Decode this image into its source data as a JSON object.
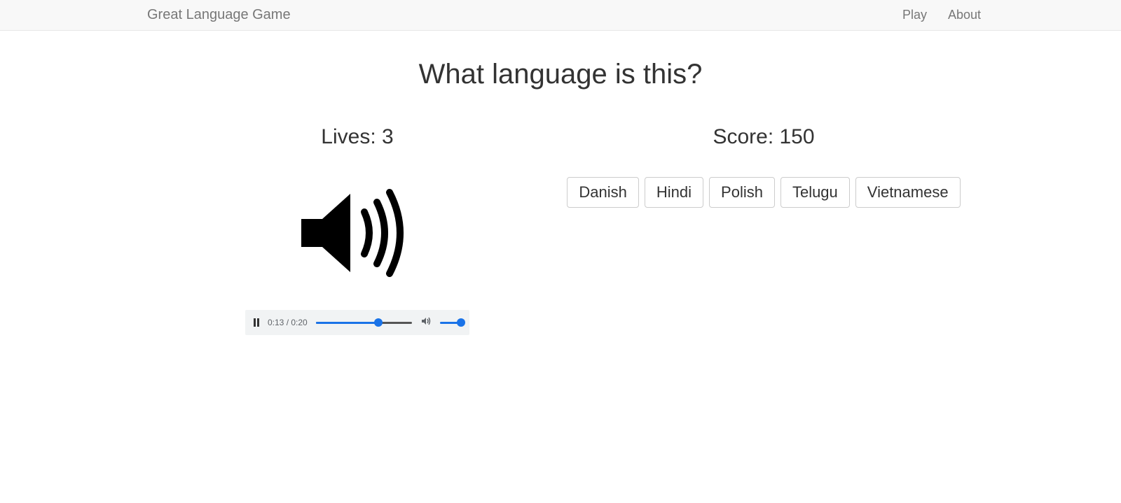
{
  "nav": {
    "brand": "Great Language Game",
    "links": [
      "Play",
      "About"
    ]
  },
  "question": "What language is this?",
  "game": {
    "lives_label": "Lives: 3",
    "score_label": "Score: 150"
  },
  "audio": {
    "time": "0:13 / 0:20"
  },
  "answers": [
    "Danish",
    "Hindi",
    "Polish",
    "Telugu",
    "Vietnamese"
  ]
}
